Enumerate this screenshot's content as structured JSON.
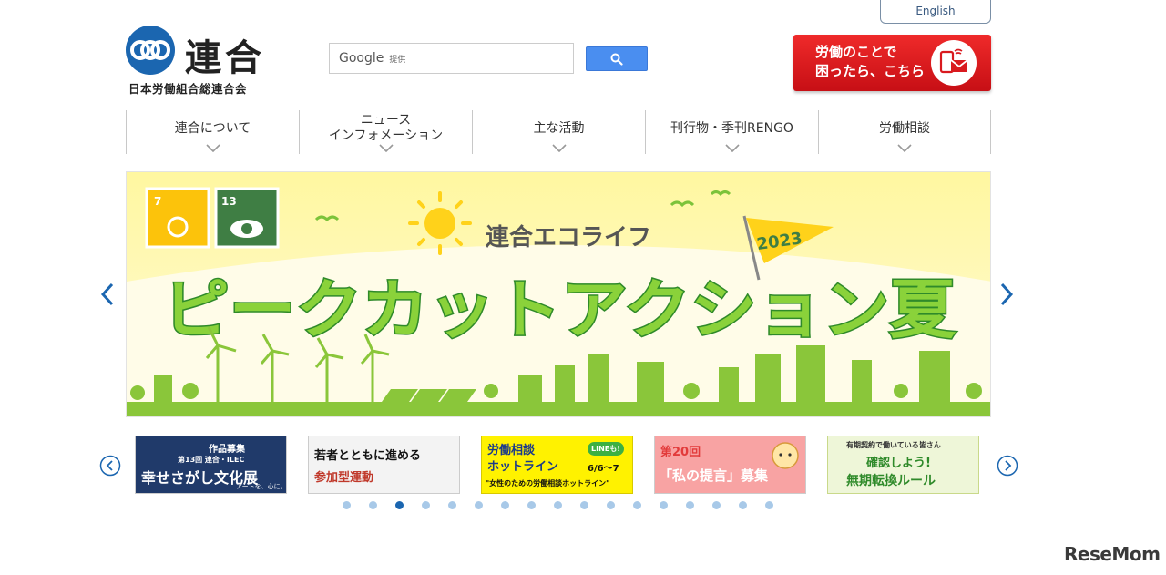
{
  "header": {
    "english_label": "English",
    "logo_name": "連合",
    "logo_sub": "日本労働組合総連合会",
    "search_brand": "Google",
    "search_provided": "提供",
    "consult_line1": "労働のことで",
    "consult_line2": "困ったら、こちら"
  },
  "nav": {
    "items": [
      {
        "label": "連合について"
      },
      {
        "label": "ニュース\nインフォメーション"
      },
      {
        "label": "主な活動"
      },
      {
        "label": "刊行物・季刊RENGO"
      },
      {
        "label": "労働相談"
      }
    ]
  },
  "hero": {
    "sdg_7": "7",
    "sdg_13": "13",
    "subtitle": "連合エコライフ",
    "year": "2023",
    "title": "ピークカットアクション夏"
  },
  "thumbnails": [
    {
      "line1": "作品募集",
      "line2": "第13回 連合・ILEC",
      "line3": "幸せさがし文化展",
      "line4": "アートを、心に。"
    },
    {
      "line1": "若者とともに進める",
      "line2": "参加型運動"
    },
    {
      "line1": "労働相談",
      "line2": "ホットライン",
      "line3": "LINEも!",
      "line4": "6/6〜7",
      "line5": "\"女性のための労働相談ホットライン\""
    },
    {
      "line1": "第20回",
      "line2": "「私の提言」募集"
    },
    {
      "line1": "有期契約で働いている皆さん",
      "line2": "確認しよう!",
      "line3": "無期転換ルール"
    }
  ],
  "carousel": {
    "dot_count": 17,
    "active_index": 2
  },
  "watermark": "ReseMom",
  "colors": {
    "brand_blue": "#1b66b0",
    "consult_red": "#d91a1f",
    "hero_green": "#7cc33a",
    "hero_yellow": "#fff56a"
  }
}
